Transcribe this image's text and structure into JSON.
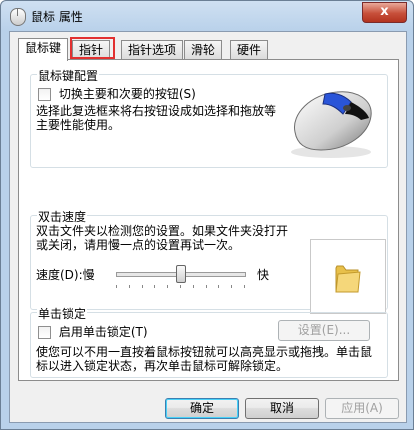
{
  "window": {
    "title": "鼠标 属性",
    "close_label": "x"
  },
  "tabs": [
    {
      "label": "鼠标键",
      "active": true
    },
    {
      "label": "指针",
      "active": false,
      "highlighted": true
    },
    {
      "label": "指针选项",
      "active": false
    },
    {
      "label": "滑轮",
      "active": false
    },
    {
      "label": "硬件",
      "active": false
    }
  ],
  "buttons_config": {
    "title": "鼠标键配置",
    "swap_label": "切换主要和次要的按钮(S)",
    "swap_checked": false,
    "description": "选择此复选框来将右按钮设成如选择和拖放等主要性能使用。"
  },
  "double_click": {
    "title": "双击速度",
    "description": "双击文件夹以检测您的设置。如果文件夹没打开或关闭，请用慢一点的设置再试一次。",
    "speed_label": "速度(D):慢",
    "fast_label": "快",
    "speed_level": 0.5
  },
  "click_lock": {
    "title": "单击锁定",
    "enable_label": "启用单击锁定(T)",
    "enable_checked": false,
    "settings_button": "设置(E)...",
    "description": "使您可以不用一直按着鼠标按钮就可以高亮显示或拖拽。单击鼠标以进入锁定状态，再次单击鼠标可解除锁定。"
  },
  "footer": {
    "ok": "确定",
    "cancel": "取消",
    "apply": "应用(A)"
  },
  "colors": {
    "highlight_border": "#e23030",
    "accent": "#3c7fb1"
  },
  "icons": [
    "mouse-icon",
    "mouse-image",
    "folder-icon",
    "close-icon"
  ]
}
